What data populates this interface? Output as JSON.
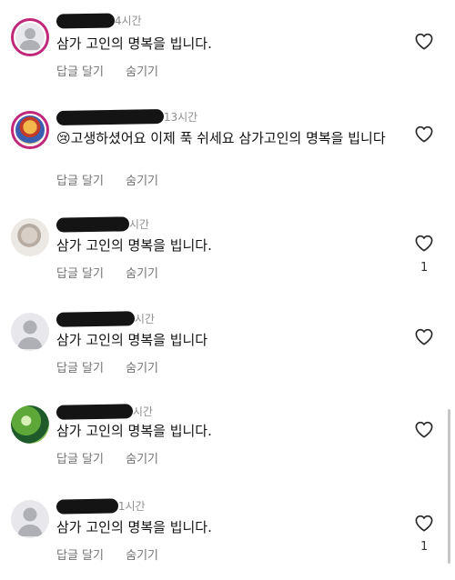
{
  "comments": [
    {
      "time": "4시간",
      "text": "삼가 고인의 명복을 빕니다.",
      "reply_label": "답글 달기",
      "hide_label": "숨기기",
      "likes": "",
      "avatar": "default-avatar-icon"
    },
    {
      "time": "13시간",
      "emoji": "😢",
      "text": "고생하셨어요 이제 푹 쉬세요  삼가고인의 명복을 빕니다",
      "reply_label": "답글 달기",
      "hide_label": "숨기기",
      "likes": "",
      "avatar": "cartoon-avatar-icon"
    },
    {
      "time": "시간",
      "text": "삼가 고인의 명복을 빕니다.",
      "reply_label": "답글 달기",
      "hide_label": "숨기기",
      "likes": "1",
      "avatar": "sketch-avatar-icon"
    },
    {
      "time": "시간",
      "text": "삼가 고인의 명복을 빕니다",
      "reply_label": "답글 달기",
      "hide_label": "숨기기",
      "likes": "",
      "avatar": "default-avatar-icon"
    },
    {
      "time": "시간",
      "text": "삼가 고인의 명복을 빕니다.",
      "reply_label": "답글 달기",
      "hide_label": "숨기기",
      "likes": "",
      "avatar": "green-avatar-icon"
    },
    {
      "time": "1시간",
      "text": "삼가 고인의 명복을 빕니다.",
      "reply_label": "답글 달기",
      "hide_label": "숨기기",
      "likes": "1",
      "avatar": "default-avatar-icon"
    }
  ],
  "colors": {
    "ring": "#c2287a",
    "muted": "#8e8e8e",
    "text": "#111111"
  }
}
